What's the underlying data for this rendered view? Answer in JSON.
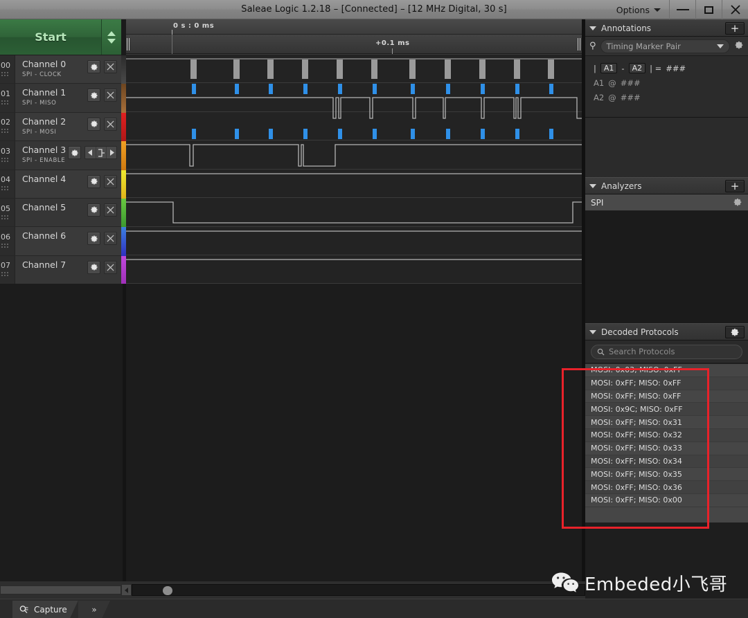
{
  "titlebar": {
    "title": "Saleae Logic 1.2.18 – [Connected] – [12 MHz Digital, 30 s]",
    "options_label": "Options",
    "minimize_icon": "minimize-icon",
    "maximize_icon": "maximize-icon",
    "close_icon": "close-icon"
  },
  "sidebar": {
    "start_label": "Start",
    "channels": [
      {
        "num": "00",
        "name": "Channel 0",
        "sub": "SPI - CLOCK",
        "color": "#3a3a3a",
        "controls": "gear-close"
      },
      {
        "num": "01",
        "name": "Channel 1",
        "sub": "SPI - MISO",
        "color": "#8a5a2b",
        "controls": "gear-close"
      },
      {
        "num": "02",
        "name": "Channel 2",
        "sub": "SPI - MOSI",
        "color": "#d82222",
        "controls": "gear-close"
      },
      {
        "num": "03",
        "name": "Channel 3",
        "sub": "SPI - ENABLE",
        "color": "#e2901b",
        "controls": "gear-trigger"
      },
      {
        "num": "04",
        "name": "Channel 4",
        "sub": "",
        "color": "#e8d31c",
        "controls": "gear-close"
      },
      {
        "num": "05",
        "name": "Channel 5",
        "sub": "",
        "color": "#4bb43c",
        "controls": "gear-close"
      },
      {
        "num": "06",
        "name": "Channel 6",
        "sub": "",
        "color": "#3464d8",
        "controls": "gear-close"
      },
      {
        "num": "07",
        "name": "Channel 7",
        "sub": "",
        "color": "#b43ccc",
        "controls": "gear-close"
      }
    ]
  },
  "timeline": {
    "origin_label": "0 s : 0 ms",
    "offset_label": "+0.1 ms"
  },
  "annotations": {
    "title": "Annotations",
    "add_label": "+",
    "marker_type": "Timing Marker Pair",
    "delta_prefix": "|",
    "a1_key": "A1",
    "dash": "-",
    "a2_key": "A2",
    "delta_suffix": "| =",
    "delta_value": "###",
    "a1_label": "A1",
    "a1_at": "@",
    "a1_value": "###",
    "a2_label": "A2",
    "a2_at": "@",
    "a2_value": "###"
  },
  "analyzers": {
    "title": "Analyzers",
    "add_label": "+",
    "items": [
      {
        "name": "SPI"
      }
    ]
  },
  "decoded": {
    "title": "Decoded Protocols",
    "search_placeholder": "Search Protocols",
    "rows": [
      "MOSI: 0x03;  MISO: 0xFF",
      "MOSI: 0xFF;  MISO: 0xFF",
      "MOSI: 0xFF;  MISO: 0xFF",
      "MOSI: 0x9C;  MISO: 0xFF",
      "MOSI: 0xFF;  MISO: 0x31",
      "MOSI: 0xFF;  MISO: 0x32",
      "MOSI: 0xFF;  MISO: 0x33",
      "MOSI: 0xFF;  MISO: 0x34",
      "MOSI: 0xFF;  MISO: 0x35",
      "MOSI: 0xFF;  MISO: 0x36",
      "MOSI: 0xFF;  MISO: 0x00"
    ],
    "highlight_color": "#e8222a"
  },
  "statusbar": {
    "capture_label": "Capture",
    "more_label": "»"
  },
  "watermark": {
    "text": "Embeded小飞哥",
    "icon": "wechat-icon"
  }
}
